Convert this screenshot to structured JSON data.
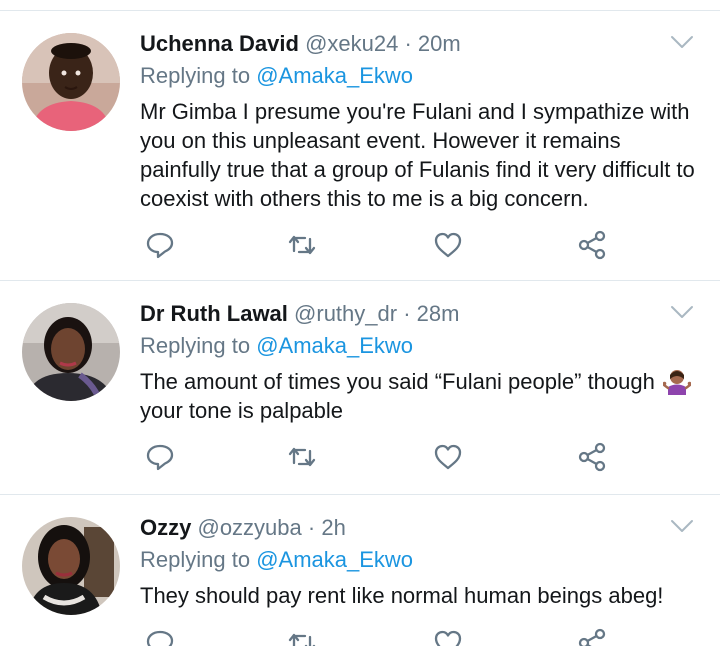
{
  "tweets": [
    {
      "name": "Uchenna David",
      "handle": "@xeku24",
      "time": "· 20m",
      "replying_prefix": "Replying to ",
      "replying_to": "@Amaka_Ekwo",
      "text": "Mr Gimba I presume you're Fulani and I sympathize with you on this unpleasant event. However it remains painfully true that a group of Fulanis find it very difficult to coexist with others this to me is a big concern."
    },
    {
      "name": "Dr Ruth Lawal",
      "handle": "@ruthy_dr",
      "time": "· 28m",
      "replying_prefix": "Replying to ",
      "replying_to": "@Amaka_Ekwo",
      "text": "The amount of times you said “Fulani people” though ",
      "text_after": "your tone is palpable",
      "emoji": "woman-shrugging-emoji"
    },
    {
      "name": "Ozzy",
      "handle": "@ozzyuba",
      "time": "· 2h",
      "replying_prefix": "Replying to ",
      "replying_to": "@Amaka_Ekwo",
      "text": "They should pay rent like normal human beings abeg!"
    }
  ],
  "icons": {
    "reply": "reply-icon",
    "retweet": "retweet-icon",
    "like": "like-icon",
    "share": "share-icon",
    "more": "chevron-down-icon"
  },
  "colors": {
    "name_text": "#14171a",
    "secondary_text": "#657786",
    "mention": "#1b95e0",
    "divider": "#e1e8ed",
    "icon": "#657786"
  }
}
